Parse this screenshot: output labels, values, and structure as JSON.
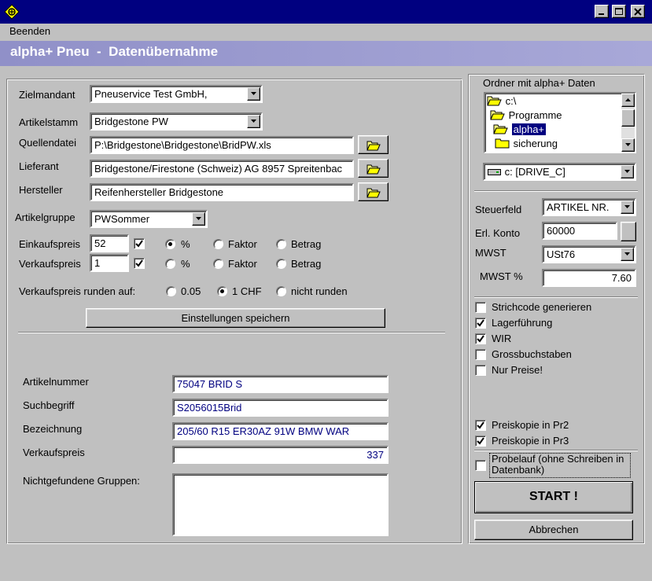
{
  "menu": {
    "beenden": "Beenden"
  },
  "header": {
    "title": "alpha+ Pneu  -  Datenübernahme"
  },
  "form": {
    "zielmandant_label": "Zielmandant",
    "zielmandant_value": "Pneuservice Test GmbH,",
    "artikelstamm_label": "Artikelstamm",
    "artikelstamm_value": "Bridgestone PW",
    "quelldatei_label": "Quellendatei",
    "quelldatei_value": "P:\\Bridgestone\\Bridgestone\\BridPW.xls",
    "lieferant_label": "Lieferant",
    "lieferant_value": "Bridgestone/Firestone (Schweiz) AG 8957 Spreitenbac",
    "hersteller_label": "Hersteller",
    "hersteller_value": "Reifenhersteller Bridgestone",
    "artikelgruppe_label": "Artikelgruppe",
    "artikelgruppe_value": "PWSommer",
    "einkaufspreis_label": "Einkaufspreis",
    "einkaufspreis_value": "52",
    "verkaufspreis_label": "Verkaufspreis",
    "verkaufspreis_value": "1",
    "opt_percent": "%",
    "opt_faktor": "Faktor",
    "opt_betrag": "Betrag",
    "runden_label": "Verkaufspreis runden auf:",
    "runden_005": "0.05",
    "runden_1chf": "1 CHF",
    "runden_nicht": "nicht runden",
    "save_button": "Einstellungen speichern"
  },
  "status": {
    "artikelnummer_label": "Artikelnummer",
    "artikelnummer_value": "75047 BRID S",
    "suchbegriff_label": "Suchbegriff",
    "suchbegriff_value": "S2056015Brid",
    "bezeichnung_label": "Bezeichnung",
    "bezeichnung_value": "205/60 R15 ER30AZ 91W BMW WAR",
    "verkaufspreis_label": "Verkaufspreis",
    "verkaufspreis_value": "337",
    "nichtgefunden_label": "Nichtgefundene Gruppen:"
  },
  "folders": {
    "title": "Ordner mit alpha+ Daten",
    "items": [
      "c:\\",
      "Programme",
      "alpha+",
      "sicherung"
    ],
    "drive": "c: [DRIVE_C]"
  },
  "settings": {
    "steuerfeld_label": "Steuerfeld",
    "steuerfeld_value": "ARTIKEL NR.",
    "konto_label": "Erl. Konto",
    "konto_value": "60000",
    "mwst_label": "MWST",
    "mwst_value": "USt76",
    "mwst_pct_label": "MWST %",
    "mwst_pct_value": "7.60"
  },
  "options": {
    "strichcode": "Strichcode generieren",
    "lager": "Lagerführung",
    "wir": "WIR",
    "gross": "Grossbuchstaben",
    "nurpreise": "Nur Preise!",
    "pr2": "Preiskopie in Pr2",
    "pr3": "Preiskopie in Pr3",
    "probelauf": "Probelauf (ohne Schreiben in Datenbank)"
  },
  "actions": {
    "start": "START !",
    "abbrechen": "Abbrechen"
  },
  "colors": {
    "titlebar": "#000080",
    "header_band": "#a0a0d0",
    "selection": "#000080"
  }
}
